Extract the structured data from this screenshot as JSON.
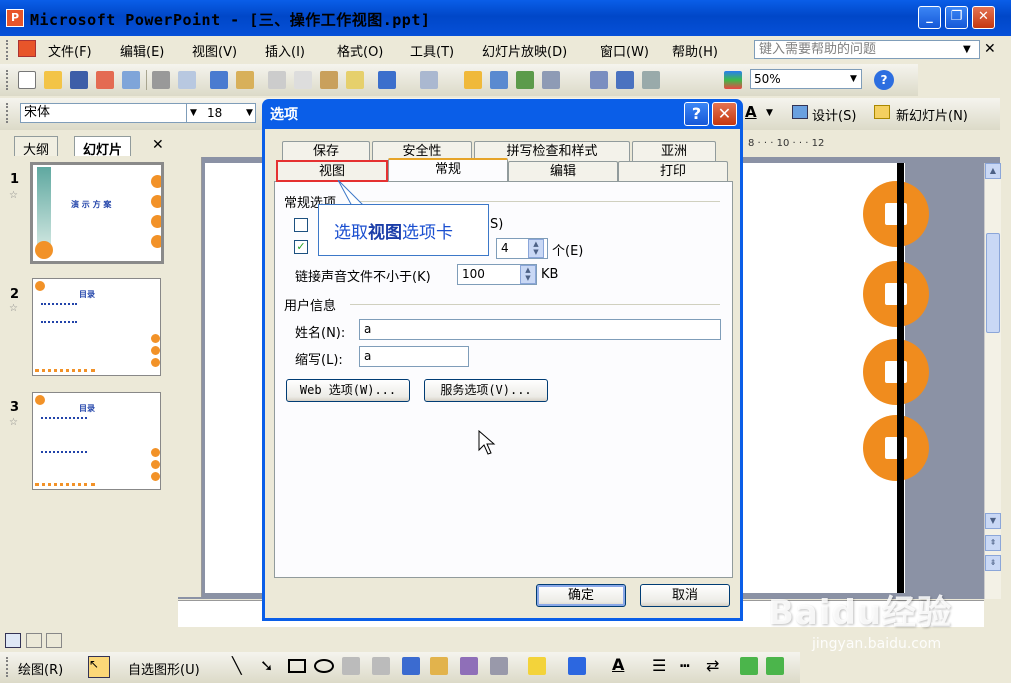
{
  "window": {
    "title": "Microsoft PowerPoint - [三、操作工作视图.ppt]",
    "app_icon": "powerpoint-icon"
  },
  "menubar": {
    "items": [
      "文件(F)",
      "编辑(E)",
      "视图(V)",
      "插入(I)",
      "格式(O)",
      "工具(T)",
      "幻灯片放映(D)",
      "窗口(W)",
      "帮助(H)"
    ],
    "help_placeholder": "键入需要帮助的问题"
  },
  "toolbar": {
    "zoom": "50%",
    "font": "宋体",
    "font_size": "18",
    "design_label": "设计(S)",
    "new_slide_label": "新幻灯片(N)"
  },
  "left_pane": {
    "tabs": [
      "大纲",
      "幻灯片"
    ],
    "slides": [
      {
        "num": "1",
        "title": "演 示 方 案"
      },
      {
        "num": "2",
        "title": "目录"
      },
      {
        "num": "3",
        "title": "目录"
      }
    ]
  },
  "ruler": {
    "top_ticks": "8 · · · 10 · · · 12"
  },
  "dialog": {
    "title": "选项",
    "tabs_back": [
      "保存",
      "安全性",
      "拼写检查和样式",
      "亚洲"
    ],
    "tabs_front": [
      "视图",
      "常规",
      "编辑",
      "打印"
    ],
    "active_tab": "常规",
    "group_general": "常规选项",
    "recent_files_count": "4",
    "recent_files_unit": "个(E)",
    "link_sound_label": "链接声音文件不小于(K)",
    "link_sound_value": "100",
    "link_sound_unit": "KB",
    "checkbox1_suffix": "S)",
    "group_user": "用户信息",
    "name_label": "姓名(N):",
    "name_value": "a",
    "initials_label": "缩写(L):",
    "initials_value": "a",
    "web_options": "Web 选项(W)...",
    "service_options": "服务选项(V)...",
    "ok": "确定",
    "cancel": "取消"
  },
  "callout": {
    "prefix": "选取",
    "bold": "视图",
    "suffix": "选项卡"
  },
  "bottom_toolbar": {
    "draw_label": "绘图(R)",
    "autoshape_label": "自选图形(U)"
  },
  "watermark": {
    "text": "Baidu经验",
    "url": "jingyan.baidu.com"
  }
}
